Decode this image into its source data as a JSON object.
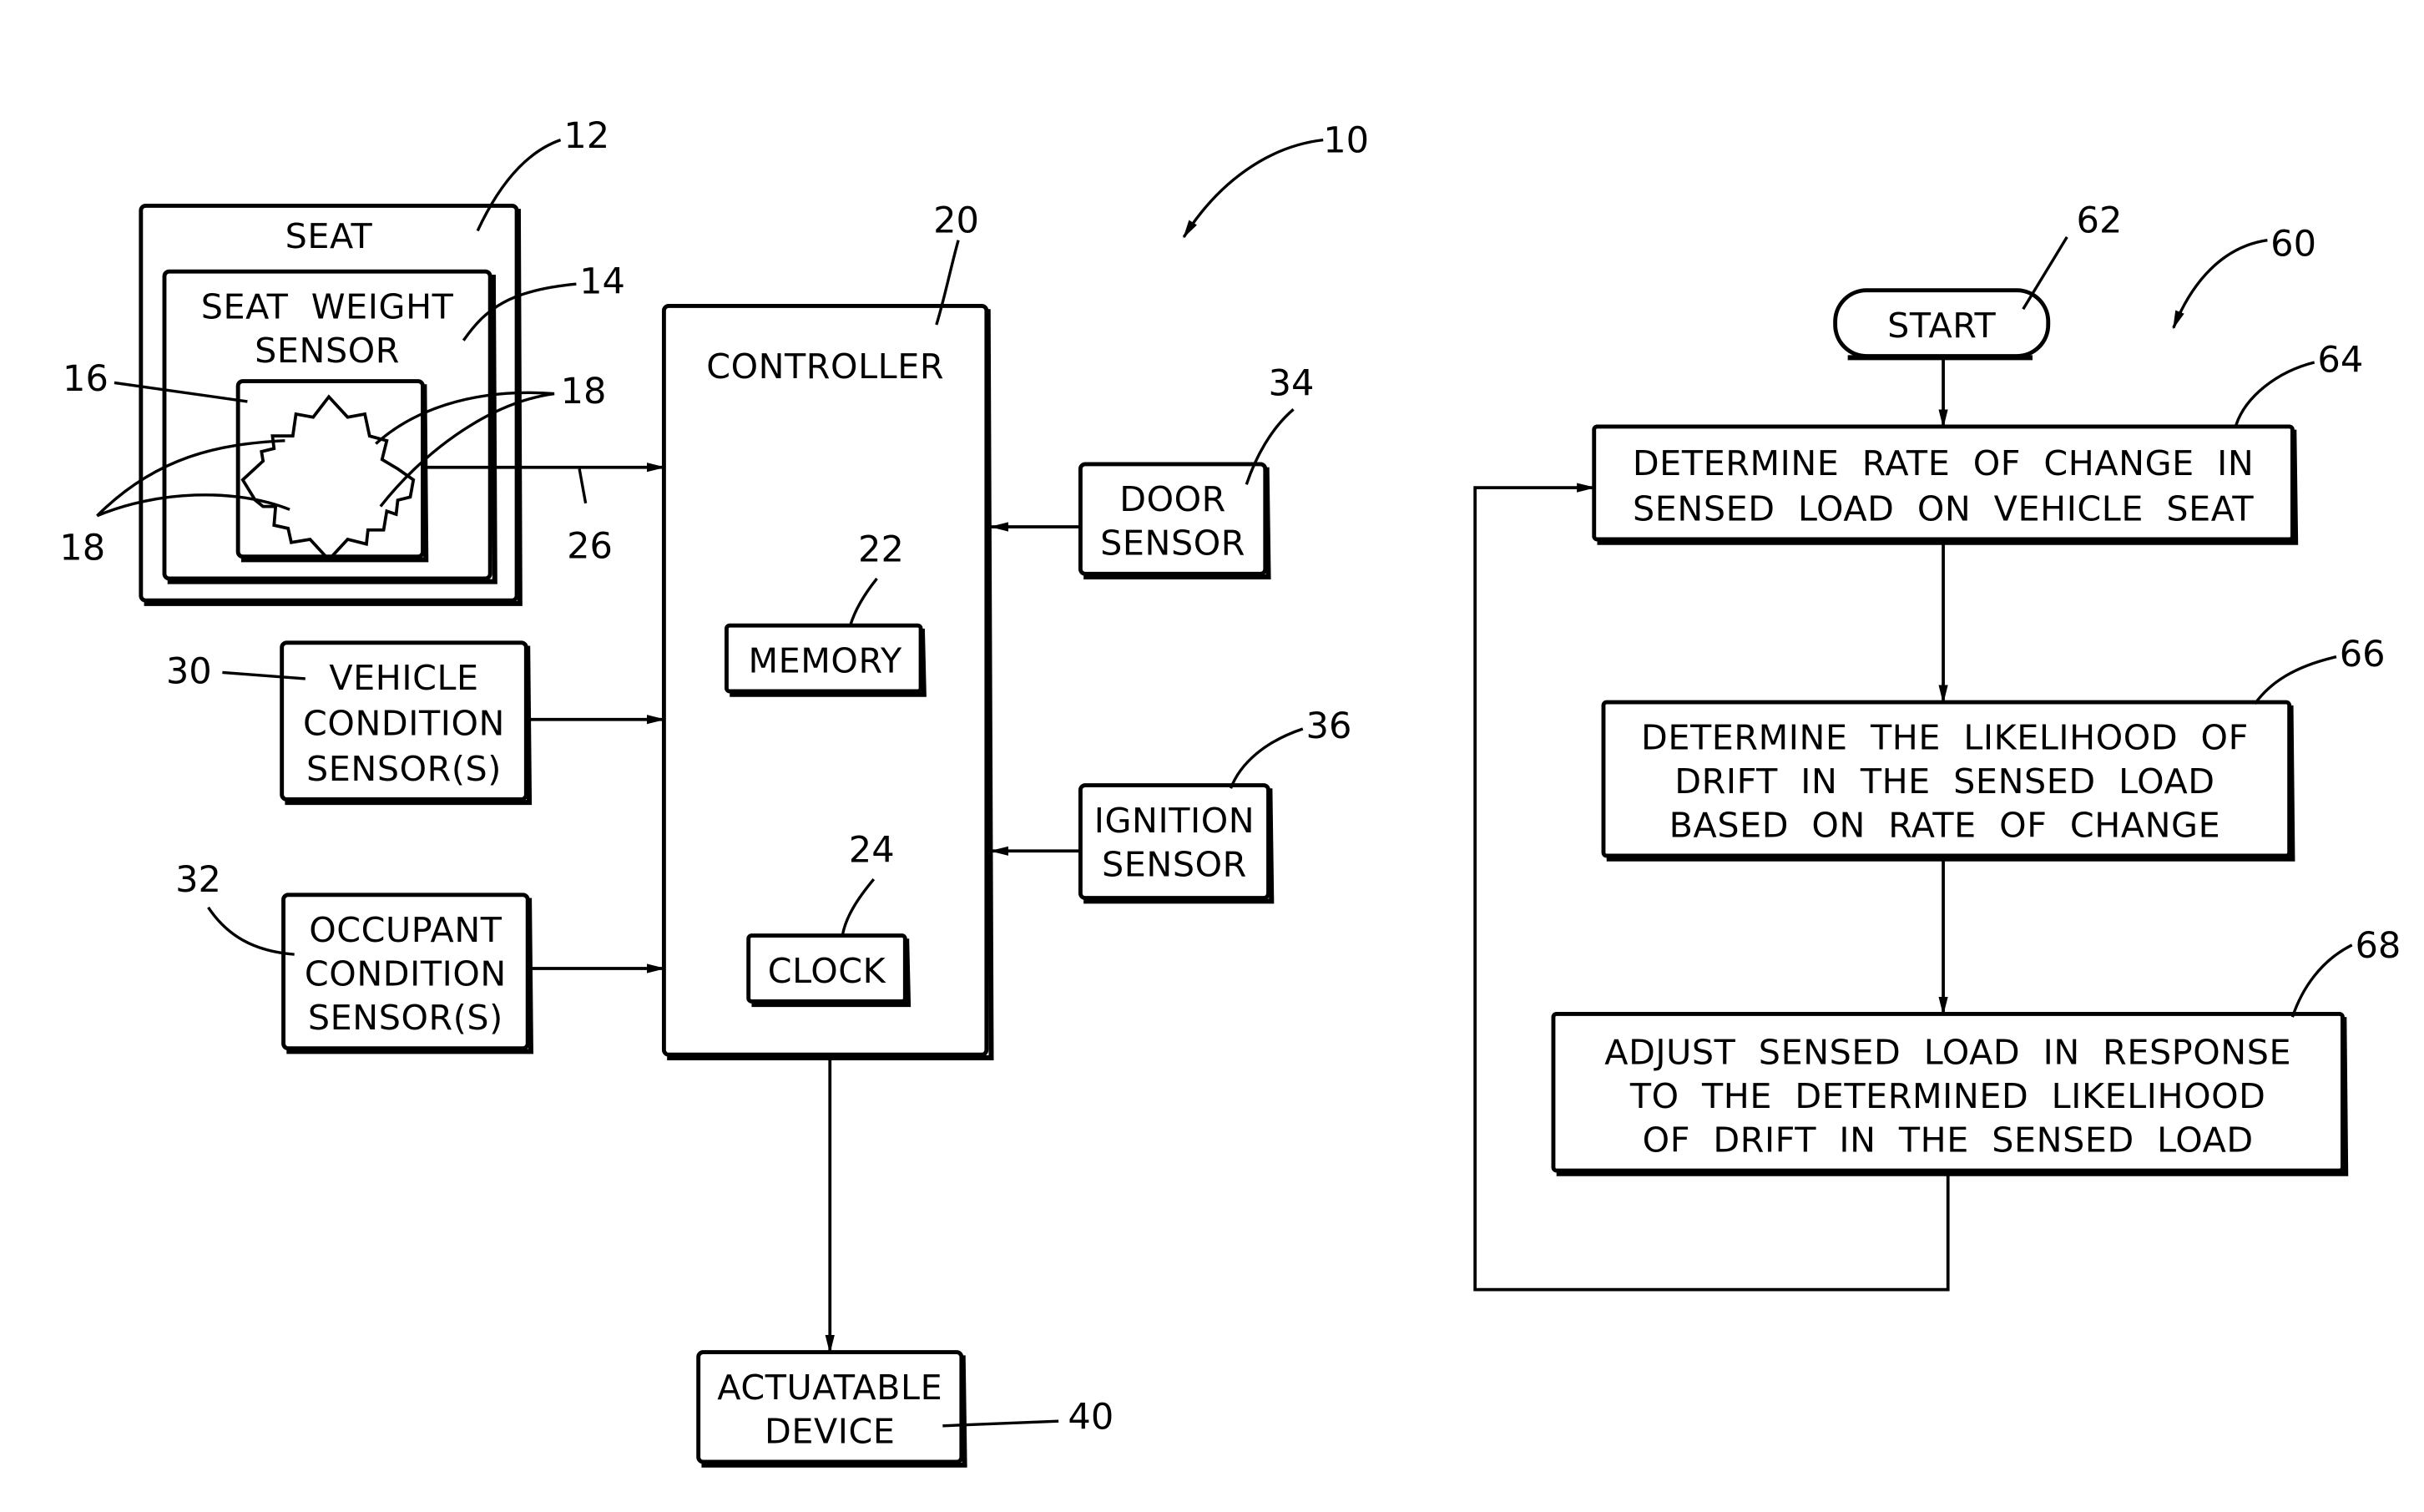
{
  "figure": {
    "system_ref": "10",
    "flowchart_ref": "60"
  },
  "block_diagram": {
    "seat": {
      "label": "SEAT",
      "ref": "12"
    },
    "seat_weight_sensor": {
      "label_lines": [
        "SEAT  WEIGHT",
        "SENSOR"
      ],
      "ref": "14"
    },
    "sensor_element": {
      "ref": "16"
    },
    "strain_gauges": {
      "ref_right": "18",
      "ref_left": "18"
    },
    "sensor_output_line": {
      "ref": "26"
    },
    "controller": {
      "label": "CONTROLLER",
      "ref": "20"
    },
    "memory": {
      "label": "MEMORY",
      "ref": "22"
    },
    "clock": {
      "label": "CLOCK",
      "ref": "24"
    },
    "vehicle_condition_sensors": {
      "label_lines": [
        "VEHICLE",
        "CONDITION",
        "SENSOR(S)"
      ],
      "ref": "30"
    },
    "occupant_condition_sensors": {
      "label_lines": [
        "OCCUPANT",
        "CONDITION",
        "SENSOR(S)"
      ],
      "ref": "32"
    },
    "door_sensor": {
      "label_lines": [
        "DOOR",
        "SENSOR"
      ],
      "ref": "34"
    },
    "ignition_sensor": {
      "label_lines": [
        "IGNITION",
        "SENSOR"
      ],
      "ref": "36"
    },
    "actuatable_device": {
      "label_lines": [
        "ACTUATABLE",
        "DEVICE"
      ],
      "ref": "40"
    }
  },
  "flowchart": {
    "start": {
      "label": "START",
      "ref": "62"
    },
    "steps": [
      {
        "ref": "64",
        "lines": [
          "DETERMINE  RATE  OF  CHANGE  IN",
          "SENSED  LOAD  ON  VEHICLE  SEAT"
        ]
      },
      {
        "ref": "66",
        "lines": [
          "DETERMINE  THE  LIKELIHOOD  OF",
          "DRIFT  IN  THE  SENSED  LOAD",
          "BASED  ON  RATE  OF  CHANGE"
        ]
      },
      {
        "ref": "68",
        "lines": [
          "ADJUST  SENSED  LOAD  IN  RESPONSE",
          "TO  THE  DETERMINED  LIKELIHOOD",
          "OF  DRIFT  IN  THE  SENSED  LOAD"
        ]
      }
    ]
  }
}
